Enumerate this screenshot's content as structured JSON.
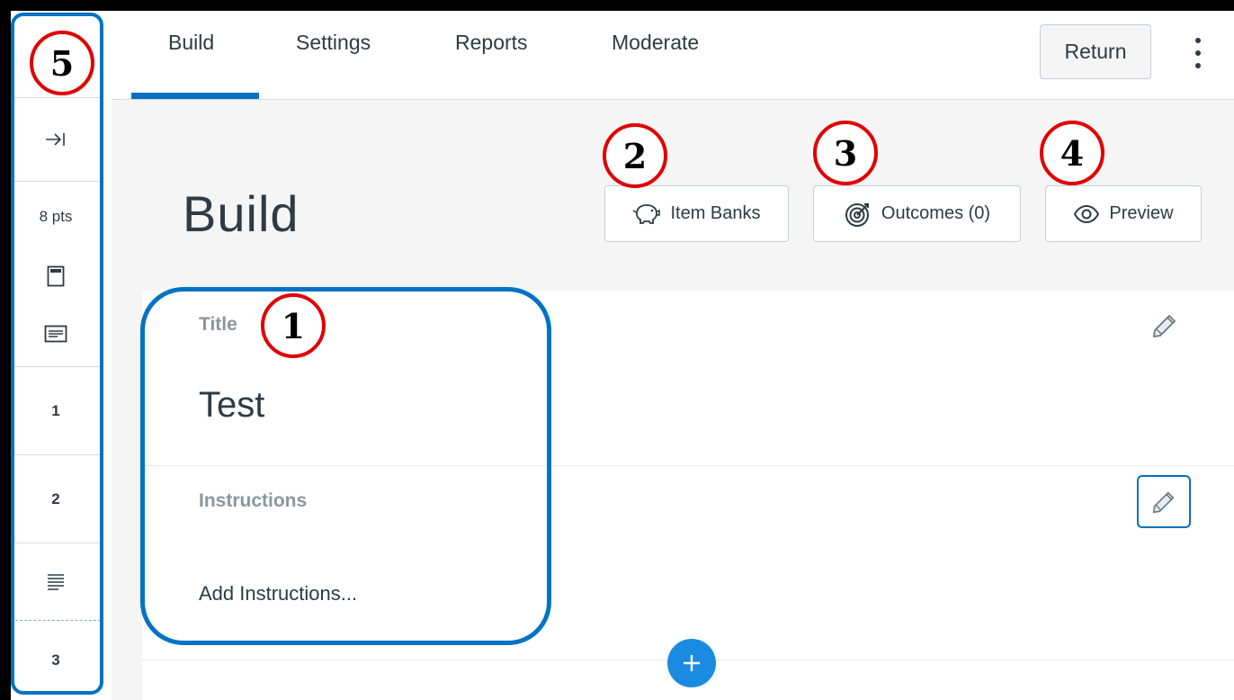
{
  "nav": {
    "tabs": [
      {
        "label": "Build"
      },
      {
        "label": "Settings"
      },
      {
        "label": "Reports"
      },
      {
        "label": "Moderate"
      }
    ],
    "return_label": "Return"
  },
  "rail": {
    "points_label": "8 pts",
    "items": [
      "1",
      "2",
      "3"
    ]
  },
  "header": {
    "title": "Build",
    "item_banks_label": "Item Banks",
    "outcomes_label": "Outcomes (0)",
    "preview_label": "Preview"
  },
  "quiz": {
    "title_label": "Title",
    "title_value": "Test",
    "instructions_label": "Instructions",
    "instructions_placeholder": "Add Instructions..."
  },
  "callouts": [
    "1",
    "2",
    "3",
    "4",
    "5"
  ],
  "colors": {
    "accent": "#0770c2",
    "annotation_blue": "#0073c4",
    "callout_red": "#e00000",
    "add_button": "#1a8be0"
  },
  "icons": [
    "collapse-arrow-icon",
    "page-icon",
    "text-block-icon",
    "paragraph-icon",
    "piggy-bank-icon",
    "target-icon",
    "eye-icon",
    "pencil-icon",
    "plus-icon",
    "kebab-icon"
  ]
}
